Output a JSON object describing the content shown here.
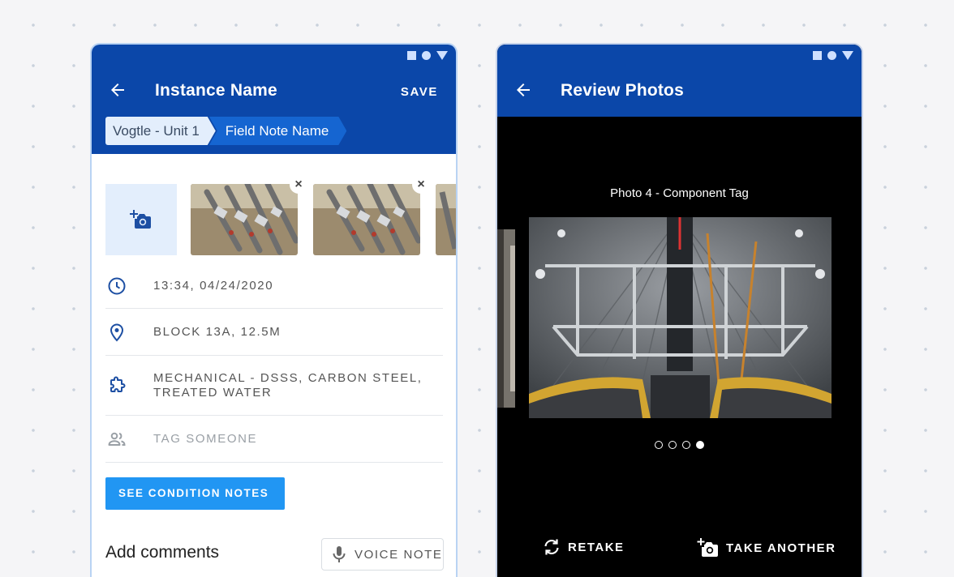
{
  "left_screen": {
    "title": "Instance Name",
    "save_label": "SAVE",
    "breadcrumb": [
      "Vogtle - Unit  1",
      "Field Note Name"
    ],
    "info_rows": [
      {
        "icon": "clock-icon",
        "text": "13:34, 04/24/2020"
      },
      {
        "icon": "location-pin-icon",
        "text": "BLOCK 13A, 12.5M"
      },
      {
        "icon": "puzzle-icon",
        "text": "MECHANICAL - DSSS, CARBON STEEL, TREATED WATER"
      },
      {
        "icon": "people-icon",
        "text": "TAG SOMEONE"
      }
    ],
    "condition_button": "SEE CONDITION NOTES",
    "comments_title": "Add comments",
    "voice_note_label": "VOICE NOTE",
    "remove_icon": "×"
  },
  "right_screen": {
    "title": "Review Photos",
    "photo_caption": "Photo 4 - Component Tag",
    "carousel": {
      "count": 4,
      "active": 4
    },
    "retake_label": "RETAKE",
    "take_another_label": "TAKE ANOTHER"
  },
  "colors": {
    "app_bar": "#0b47a9",
    "breadcrumb_active": "#1565d1",
    "breadcrumb_inactive": "#e3eefc",
    "primary_button": "#2196f3",
    "icon": "#1d4fa3"
  }
}
